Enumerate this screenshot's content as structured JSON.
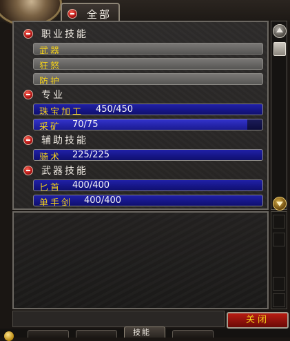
{
  "tab": {
    "label": "全部"
  },
  "skill_groups": [
    {
      "header": "职业技能",
      "skills": [
        {
          "name": "武器",
          "value": "",
          "style": "gray",
          "fill": 0
        },
        {
          "name": "狂怒",
          "value": "",
          "style": "gray",
          "fill": 0
        },
        {
          "name": "防护",
          "value": "",
          "style": "gray",
          "fill": 0
        }
      ]
    },
    {
      "header": "专业",
      "skills": [
        {
          "name": "珠宝加工",
          "value": "450/450",
          "style": "blue",
          "fill": 1.0
        },
        {
          "name": "采矿",
          "value": "70/75",
          "style": "blue",
          "fill": 0.9333
        }
      ]
    },
    {
      "header": "辅助技能",
      "skills": [
        {
          "name": "骑术",
          "value": "225/225",
          "style": "blue",
          "fill": 1.0
        }
      ]
    },
    {
      "header": "武器技能",
      "skills": [
        {
          "name": "匕首",
          "value": "400/400",
          "style": "blue",
          "fill": 1.0
        },
        {
          "name": "单手剑",
          "value": "400/400",
          "style": "blue",
          "fill": 1.0
        }
      ]
    }
  ],
  "footer": {
    "close_label": "关闭"
  },
  "bottom_tabs": [
    {
      "label": "技能",
      "active": true
    }
  ],
  "icons": {
    "collapse": "minus-circle-icon",
    "scroll_up": "arrow-up-icon",
    "scroll_down": "arrow-down-icon"
  }
}
